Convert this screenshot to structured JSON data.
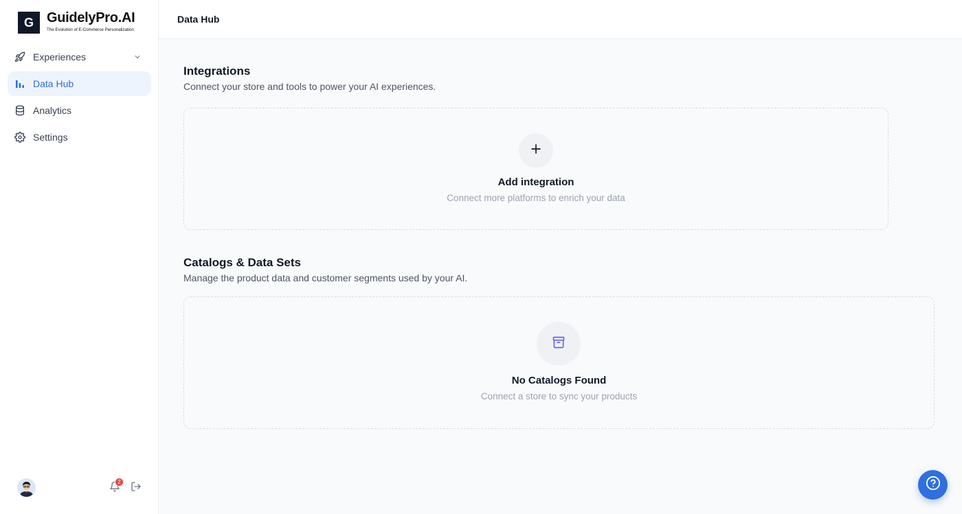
{
  "brand": {
    "mark": "G",
    "name": "GuidelyPro.AI",
    "tagline": "The Evolution of E-Commerce Personalization"
  },
  "sidebar": {
    "items": [
      {
        "label": "Experiences",
        "icon": "rocket-icon",
        "expandable": true
      },
      {
        "label": "Data Hub",
        "icon": "bar-chart-icon",
        "active": true
      },
      {
        "label": "Analytics",
        "icon": "database-icon"
      },
      {
        "label": "Settings",
        "icon": "gear-icon"
      }
    ],
    "footer": {
      "notification_count": "2"
    }
  },
  "header": {
    "title": "Data Hub"
  },
  "integrations": {
    "title": "Integrations",
    "description": "Connect your store and tools to power your AI experiences.",
    "add_card": {
      "title": "Add integration",
      "subtitle": "Connect more platforms to enrich your data",
      "icon": "plus-icon"
    }
  },
  "catalogs": {
    "title": "Catalogs & Data Sets",
    "description": "Manage the product data and customer segments used by your AI.",
    "empty_state": {
      "title": "No Catalogs Found",
      "subtitle": "Connect a store to sync your products",
      "icon": "archive-icon"
    }
  },
  "colors": {
    "accent": "#2f6fde",
    "active_bg": "#eef4fe",
    "badge": "#ef4444",
    "archive_icon": "#6366f1"
  }
}
